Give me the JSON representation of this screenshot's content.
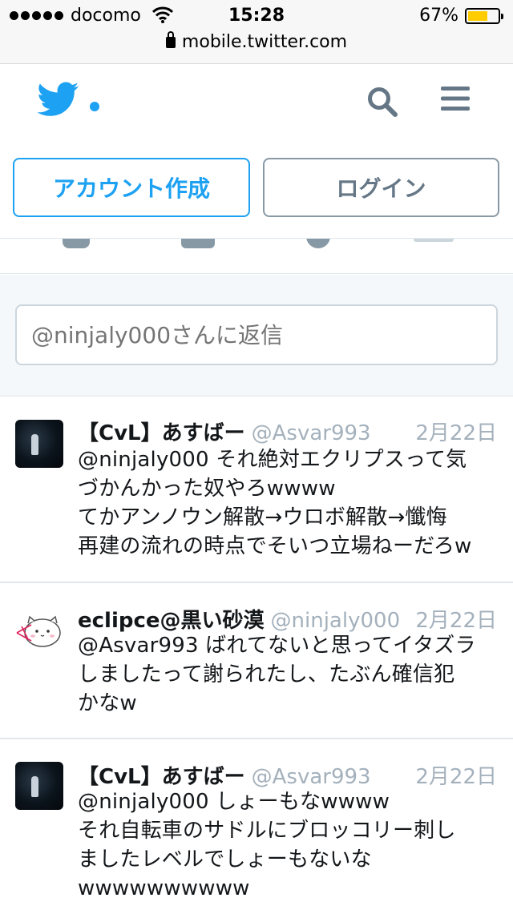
{
  "status_bar": {
    "carrier": "docomo",
    "time": "15:28",
    "battery_percent": "67%",
    "battery_level": 0.67,
    "url": "mobile.twitter.com"
  },
  "header": {
    "logo_icon": "twitter-bird-icon",
    "search_icon": "search-icon",
    "menu_icon": "hamburger-menu-icon",
    "brand_color": "#1da1f2"
  },
  "auth": {
    "signup_label": "アカウント作成",
    "login_label": "ログイン"
  },
  "reply": {
    "placeholder": "@ninjaly000さんに返信"
  },
  "tweets": [
    {
      "name": "【CvL】あすばー",
      "handle": "@Asvar993",
      "date": "2月22日",
      "text": "@ninjaly000 それ絶対エクリプスって気\nづかんかった奴やろwwww\nてかアンノウン解散→ウロボ解散→懺悔\n再建の流れの時点でそいつ立場ねーだろw"
    },
    {
      "name": "eclipce@黒い砂漠",
      "handle": "@ninjaly000",
      "date": "2月22日",
      "text": "@Asvar993 ばれてないと思ってイタズラ\nしましたって謝られたし、たぶん確信犯\nかなw"
    },
    {
      "name": "【CvL】あすばー",
      "handle": "@Asvar993",
      "date": "2月22日",
      "text": "@ninjaly000 しょーもなwwww\nそれ自転車のサドルにブロッコリー刺し\nましたレベルでしょーもないな\nwwwwwwwwww"
    }
  ]
}
